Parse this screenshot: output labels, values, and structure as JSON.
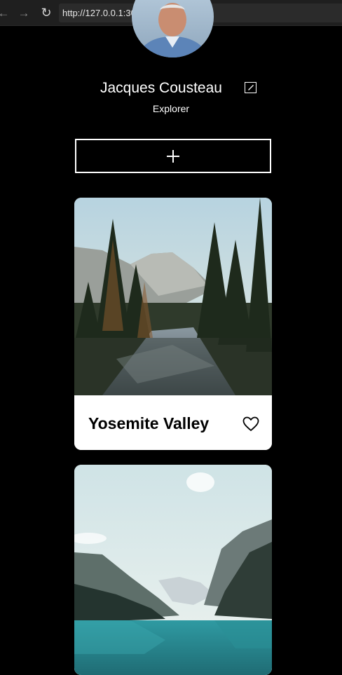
{
  "browser": {
    "url": "http://127.0.0.1:3000/index.html"
  },
  "profile": {
    "name": "Jacques Cousteau",
    "role": "Explorer"
  },
  "add_button": {
    "label": "+"
  },
  "cards": [
    {
      "title": "Yosemite Valley",
      "liked": false
    },
    {
      "title": "",
      "liked": false
    }
  ]
}
